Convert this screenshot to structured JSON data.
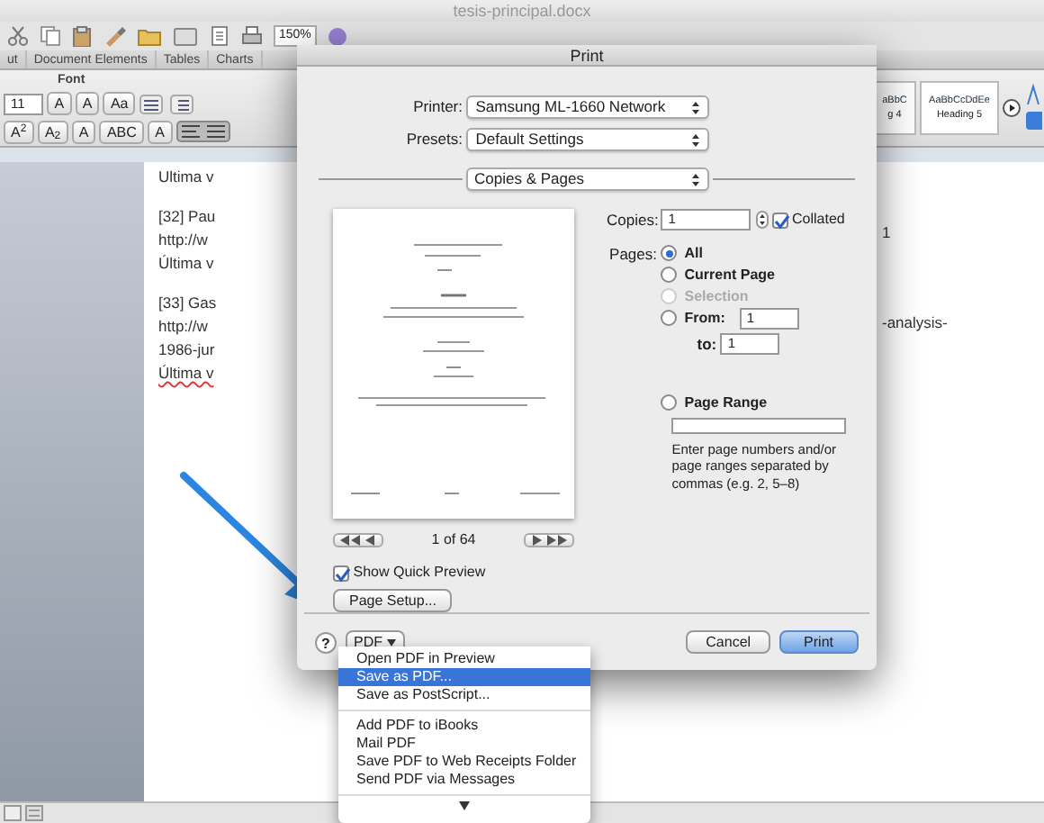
{
  "window": {
    "title": "tesis-principal.docx"
  },
  "toolbar": {
    "zoom": "150%"
  },
  "ribbon": {
    "tabs": [
      {
        "label": "ut",
        "selected": false
      },
      {
        "label": "Document Elements",
        "selected": false
      },
      {
        "label": "Tables",
        "selected": false
      },
      {
        "label": "Charts",
        "selected": false
      }
    ],
    "group_label": "Font",
    "font_size": "11",
    "row1_buttons": [
      "A",
      "A",
      "Aa"
    ],
    "row2_buttons": [
      "A$^{2}$",
      "A$_{2}$",
      "A",
      "ABC",
      "A"
    ],
    "styles": [
      {
        "sample": "aBbC",
        "name": "g 4"
      },
      {
        "sample": "AaBbCcDdEe",
        "name": "Heading 5"
      }
    ]
  },
  "document": {
    "paragraphs": [
      [
        {
          "text": "Ultima v",
          "misspelled": false
        }
      ],
      [
        {
          "text": "[32] Pau",
          "misspelled": false
        },
        {
          "text": "http://w",
          "misspelled": false
        },
        {
          "text": "Última v",
          "misspelled": false
        }
      ],
      [
        {
          "text": "[33] Gas",
          "misspelled": false
        },
        {
          "text": "http://w",
          "misspelled": false
        },
        {
          "text": "1986-jur",
          "misspelled": false
        },
        {
          "text": "Última v",
          "misspelled": true
        }
      ]
    ],
    "right_lines": [
      "1",
      "-analysis-"
    ]
  },
  "print_dialog": {
    "title": "Print",
    "printer_label": "Printer:",
    "printer": "Samsung ML-1660 Network",
    "presets_label": "Presets:",
    "presets": "Default Settings",
    "section": "Copies & Pages",
    "page_indicator": "1 of 64",
    "show_quick_preview": {
      "label": "Show Quick Preview",
      "checked": true
    },
    "page_setup": "Page Setup...",
    "copies_label": "Copies:",
    "copies": "1",
    "collated": {
      "label": "Collated",
      "checked": true
    },
    "pages_label": "Pages:",
    "page_options": [
      {
        "label": "All",
        "selected": true,
        "disabled": false
      },
      {
        "label": "Current Page",
        "selected": false,
        "disabled": false
      },
      {
        "label": "Selection",
        "selected": false,
        "disabled": true
      },
      {
        "label": "From:",
        "selected": false,
        "disabled": false
      },
      {
        "label": "Page Range",
        "selected": false,
        "disabled": false
      }
    ],
    "from": "1",
    "to_label": "to:",
    "to": "1",
    "range_hint": "Enter page numbers and/or page ranges separated by commas (e.g. 2, 5–8)",
    "help": "?",
    "pdf_button": "PDF",
    "cancel": "Cancel",
    "print": "Print"
  },
  "pdf_menu": {
    "groups": [
      [
        {
          "label": "Open PDF in Preview",
          "selected": false
        },
        {
          "label": "Save as PDF...",
          "selected": true
        },
        {
          "label": "Save as PostScript...",
          "selected": false
        }
      ],
      [
        {
          "label": "Add PDF to iBooks",
          "selected": false
        },
        {
          "label": "Mail PDF",
          "selected": false
        },
        {
          "label": "Save PDF to Web Receipts Folder",
          "selected": false
        },
        {
          "label": "Send PDF via Messages",
          "selected": false
        }
      ]
    ]
  }
}
